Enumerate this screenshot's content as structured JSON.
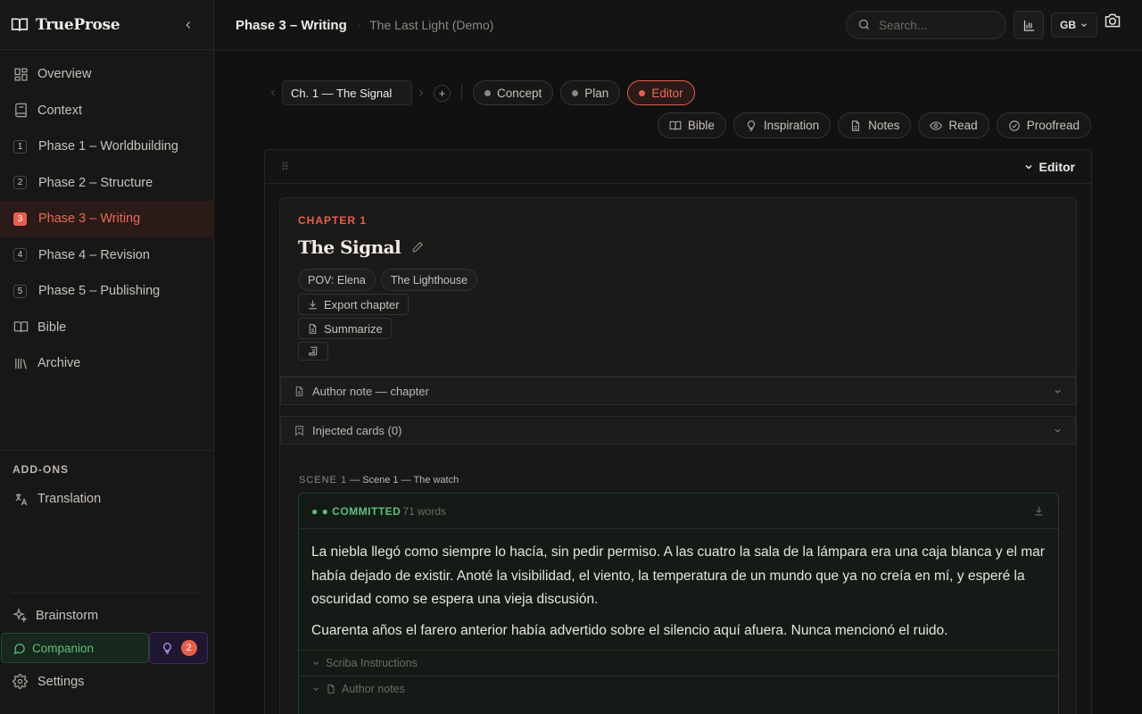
{
  "app": {
    "name": "TrueProse"
  },
  "sidebar": {
    "items": [
      {
        "label": "Overview",
        "icon": "overview-icon"
      },
      {
        "label": "Context",
        "icon": "book-icon"
      },
      {
        "label": "Phase 1 – Worldbuilding",
        "num": "1"
      },
      {
        "label": "Phase 2 – Structure",
        "num": "2"
      },
      {
        "label": "Phase 3 – Writing",
        "num": "3",
        "active": true
      },
      {
        "label": "Phase 4 – Revision",
        "num": "4"
      },
      {
        "label": "Phase 5 – Publishing",
        "num": "5"
      },
      {
        "label": "Bible",
        "icon": "open-book-icon"
      },
      {
        "label": "Archive",
        "icon": "library-icon"
      }
    ],
    "addons_title": "ADD-ONS",
    "addons": [
      {
        "label": "Translation",
        "icon": "translate-icon"
      }
    ],
    "brainstorm": "Brainstorm",
    "companion": "Companion",
    "ideas_count": "2",
    "settings": "Settings"
  },
  "header": {
    "title": "Phase 3 – Writing",
    "subtitle": "The Last Light (Demo)",
    "search_placeholder": "Search...",
    "language": "GB"
  },
  "toolbar": {
    "chapter_select": "Ch. 1 — The Signal",
    "modes": [
      "Concept",
      "Plan",
      "Editor"
    ],
    "active_mode": "Editor",
    "tools": [
      "Bible",
      "Inspiration",
      "Notes",
      "Read",
      "Proofread"
    ]
  },
  "panel": {
    "label": "Editor"
  },
  "chapter": {
    "kicker": "CHAPTER 1",
    "title": "The Signal",
    "tags": [
      "POV: Elena",
      "The Lighthouse"
    ],
    "export_label": "Export chapter",
    "summarize_label": "Summarize",
    "author_note": "Author note — chapter",
    "injected_cards": "Injected cards (0)"
  },
  "scene": {
    "number": "SCENE 1",
    "name": " — Scene 1 — The watch",
    "status": "● ● COMMITTED",
    "words": "71 words",
    "paragraphs": [
      "La niebla llegó como siempre lo hacía, sin pedir permiso. A las cuatro la sala de la lámpara era una caja blanca y el mar había dejado de existir. Anoté la visibilidad, el viento, la temperatura de un mundo que ya no creía en mí, y esperé la oscuridad como se espera una vieja discusión.",
      "Cuarenta años el farero anterior había advertido sobre el silencio aquí afuera. Nunca mencionó el ruido."
    ],
    "scriba": "Scriba Instructions",
    "author_notes": "Author notes"
  },
  "colors": {
    "accent": "#e5604b",
    "committed": "#5fbf7a",
    "companion": "#5fbf7a",
    "ideas": "#b79cf0"
  }
}
